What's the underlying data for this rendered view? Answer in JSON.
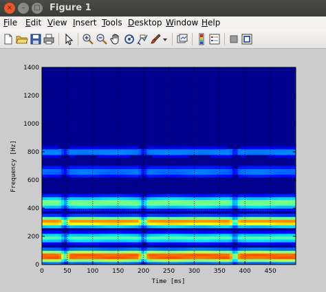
{
  "window": {
    "title": "Figure 1",
    "close_glyph": "×",
    "minimize_glyph": "–",
    "maximize_glyph": "□"
  },
  "menu": [
    {
      "pre": "",
      "u": "F",
      "post": "ile"
    },
    {
      "pre": "",
      "u": "E",
      "post": "dit"
    },
    {
      "pre": "",
      "u": "V",
      "post": "iew"
    },
    {
      "pre": "",
      "u": "I",
      "post": "nsert"
    },
    {
      "pre": "",
      "u": "T",
      "post": "ools"
    },
    {
      "pre": "",
      "u": "D",
      "post": "esktop"
    },
    {
      "pre": "",
      "u": "W",
      "post": "indow"
    },
    {
      "pre": "",
      "u": "H",
      "post": "elp"
    }
  ],
  "toolbar": {
    "icons": [
      "new-figure-icon",
      "open-file-icon",
      "save-icon",
      "print-icon",
      "select-arrow-icon",
      "zoom-in-icon",
      "zoom-out-icon",
      "pan-hand-icon",
      "rotate-3d-icon",
      "data-cursor-icon",
      "brush-icon",
      "brush-dropdown-icon",
      "link-plot-icon",
      "insert-colorbar-icon",
      "insert-legend-icon",
      "hide-plot-tools-icon",
      "show-plot-tools-icon"
    ]
  },
  "colors": {
    "figure_bg": "#cccccc",
    "titlebar": "#3b3b38",
    "close_button": "#e8582d",
    "colormap": "jet"
  },
  "chart_data": {
    "type": "heatmap",
    "title": "",
    "xlabel": "Time [ms]",
    "ylabel": "Frequency [Hz]",
    "xlim": [
      0,
      500
    ],
    "ylim": [
      0,
      1400
    ],
    "xticks": [
      0,
      50,
      100,
      150,
      200,
      250,
      300,
      350,
      400,
      450
    ],
    "yticks": [
      0,
      200,
      400,
      600,
      800,
      1000,
      1200,
      1400
    ],
    "colormap": "jet",
    "dotted_vertical_lines_ms": [
      50,
      100,
      150,
      200,
      250,
      300,
      350,
      400,
      450
    ],
    "dotted_horizontal_line_hz": 390,
    "segment_boundaries_ms": [
      45,
      200,
      380
    ],
    "bands": [
      {
        "center_hz": 60,
        "width_hz": 45,
        "intensity": 0.88
      },
      {
        "center_hz": 190,
        "width_hz": 35,
        "intensity": 0.5
      },
      {
        "center_hz": 305,
        "width_hz": 38,
        "intensity": 0.8
      },
      {
        "center_hz": 440,
        "width_hz": 45,
        "intensity": 0.55
      },
      {
        "center_hz": 660,
        "width_hz": 40,
        "intensity": 0.27
      },
      {
        "center_hz": 800,
        "width_hz": 30,
        "intensity": 0.3
      }
    ],
    "grid": false,
    "legend": "none"
  }
}
